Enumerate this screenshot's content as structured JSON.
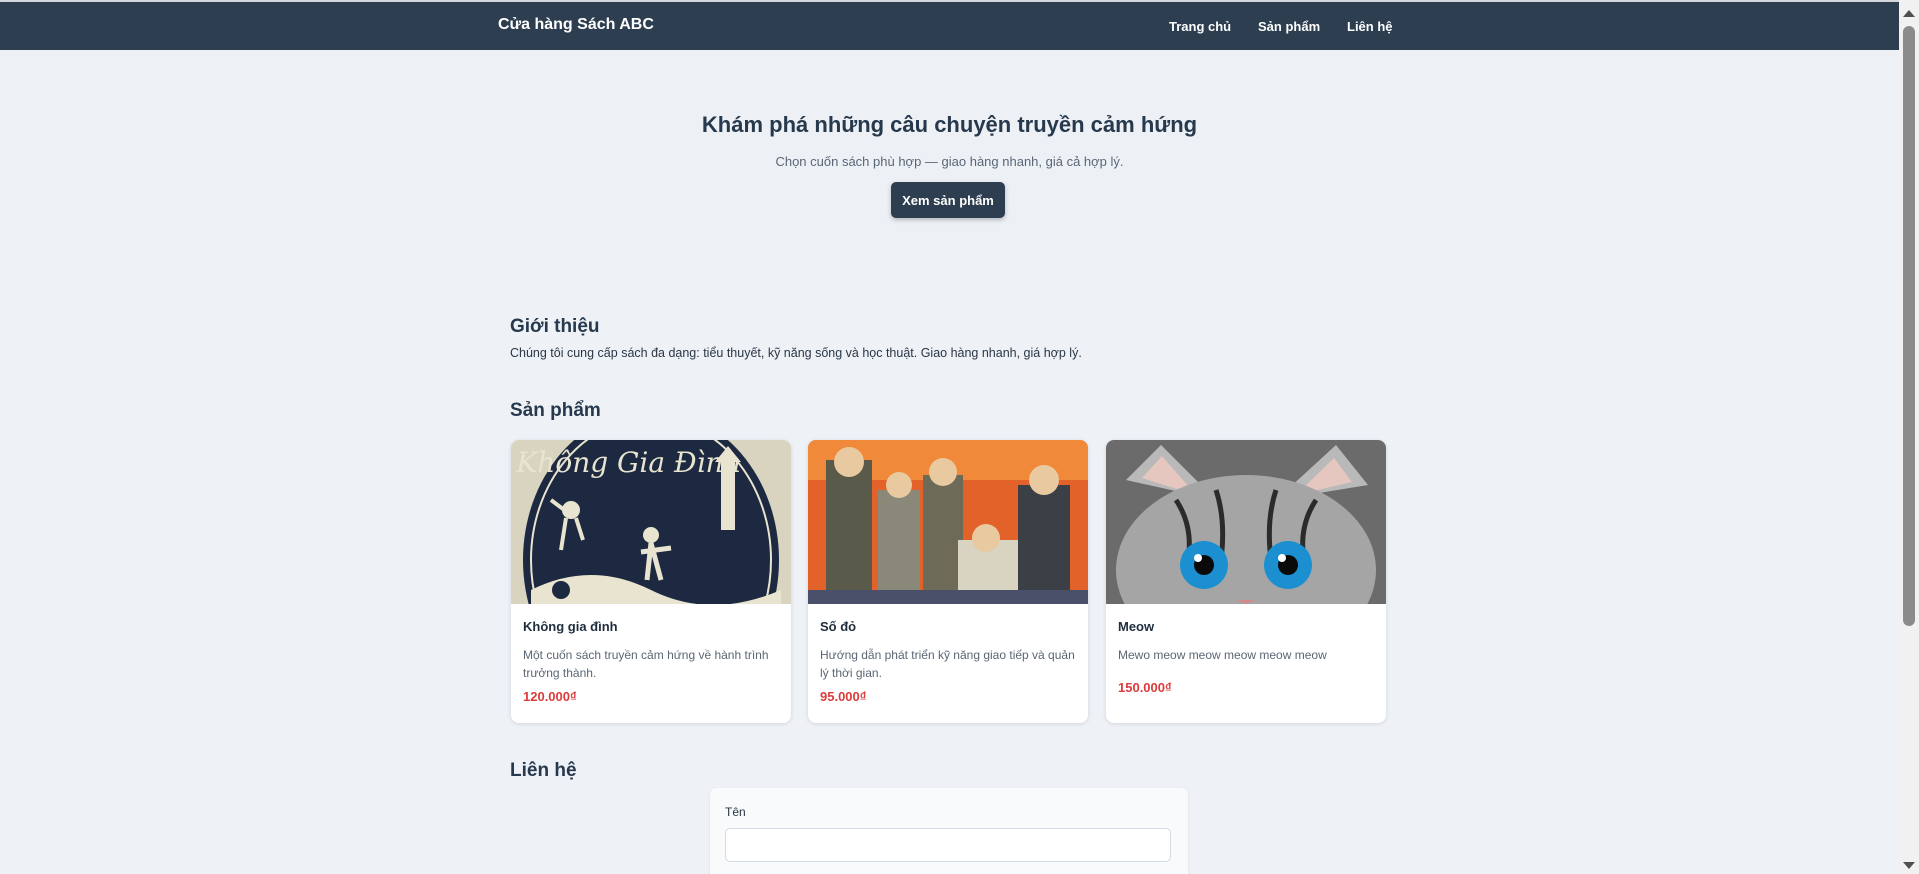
{
  "nav": {
    "brand": "Cửa hàng Sách ABC",
    "links": [
      "Trang chủ",
      "Sản phẩm",
      "Liên hệ"
    ]
  },
  "hero": {
    "title": "Khám phá những câu chuyện truyền cảm hứng",
    "subtitle": "Chọn cuốn sách phù hợp — giao hàng nhanh, giá cả hợp lý.",
    "button": "Xem sản phẩm"
  },
  "intro": {
    "heading": "Giới thiệu",
    "text": "Chúng tôi cung cấp sách đa dạng: tiểu thuyết, kỹ năng sống và học thuật. Giao hàng nhanh, giá hợp lý."
  },
  "products": {
    "heading": "Sản phẩm",
    "items": [
      {
        "title": "Không gia đình",
        "cover_text": "Không Gia Đình",
        "desc": "Một cuốn sách truyền cảm hứng về hành trình trưởng thành.",
        "price": "120.000₫"
      },
      {
        "title": "Số đỏ",
        "desc": "Hướng dẫn phát triển kỹ năng giao tiếp và quản lý thời gian.",
        "price": "95.000₫"
      },
      {
        "title": "Meow",
        "desc": "Mewo meow meow meow meow meow",
        "price": "150.000₫"
      }
    ]
  },
  "contact": {
    "heading": "Liên hệ",
    "name_label": "Tên",
    "name_value": ""
  },
  "colors": {
    "navbar": "#2d3e50",
    "background": "#eef2f7",
    "price": "#dc3b3b",
    "button": "#2d3e50"
  }
}
